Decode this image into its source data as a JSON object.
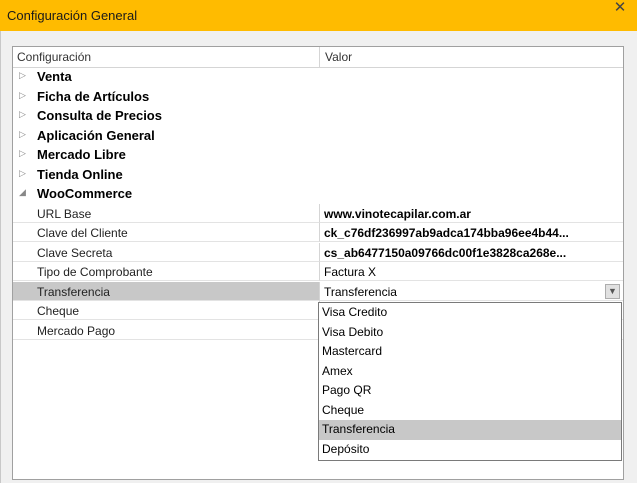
{
  "window": {
    "title": "Configuración General",
    "close_glyph": "✕"
  },
  "grid": {
    "col_config": "Configuración",
    "col_value": "Valor",
    "categories": [
      {
        "label": "Venta",
        "expanded": false
      },
      {
        "label": "Ficha de Artículos",
        "expanded": false
      },
      {
        "label": "Consulta de Precios",
        "expanded": false
      },
      {
        "label": "Aplicación General",
        "expanded": false
      },
      {
        "label": "Mercado Libre",
        "expanded": false
      },
      {
        "label": "Tienda Online",
        "expanded": false
      },
      {
        "label": "WooCommerce",
        "expanded": true
      }
    ],
    "collapsed_glyph": "▷",
    "expanded_glyph": "◢",
    "properties": [
      {
        "name": "URL Base",
        "value": "www.vinotecapilar.com.ar",
        "bold": true
      },
      {
        "name": "Clave del Cliente",
        "value": "ck_c76df236997ab9adca174bba96ee4b44...",
        "bold": true
      },
      {
        "name": "Clave Secreta",
        "value": "cs_ab6477150a09766dc00f1e3828ca268e...",
        "bold": true
      },
      {
        "name": "Tipo de Comprobante",
        "value": "Factura X",
        "bold": false
      },
      {
        "name": "Transferencia",
        "value": "Transferencia",
        "bold": false,
        "selected": true
      },
      {
        "name": "Cheque",
        "value": "",
        "bold": false
      },
      {
        "name": "Mercado Pago",
        "value": "",
        "bold": false
      }
    ]
  },
  "dropdown": {
    "options": [
      "Visa Credito",
      "Visa Debito",
      "Mastercard",
      "Amex",
      "Pago QR",
      "Cheque",
      "Transferencia",
      "Depósito"
    ],
    "selected": "Transferencia"
  },
  "colors": {
    "titlebar": "#ffbb00",
    "selection": "#c8c8c8"
  }
}
